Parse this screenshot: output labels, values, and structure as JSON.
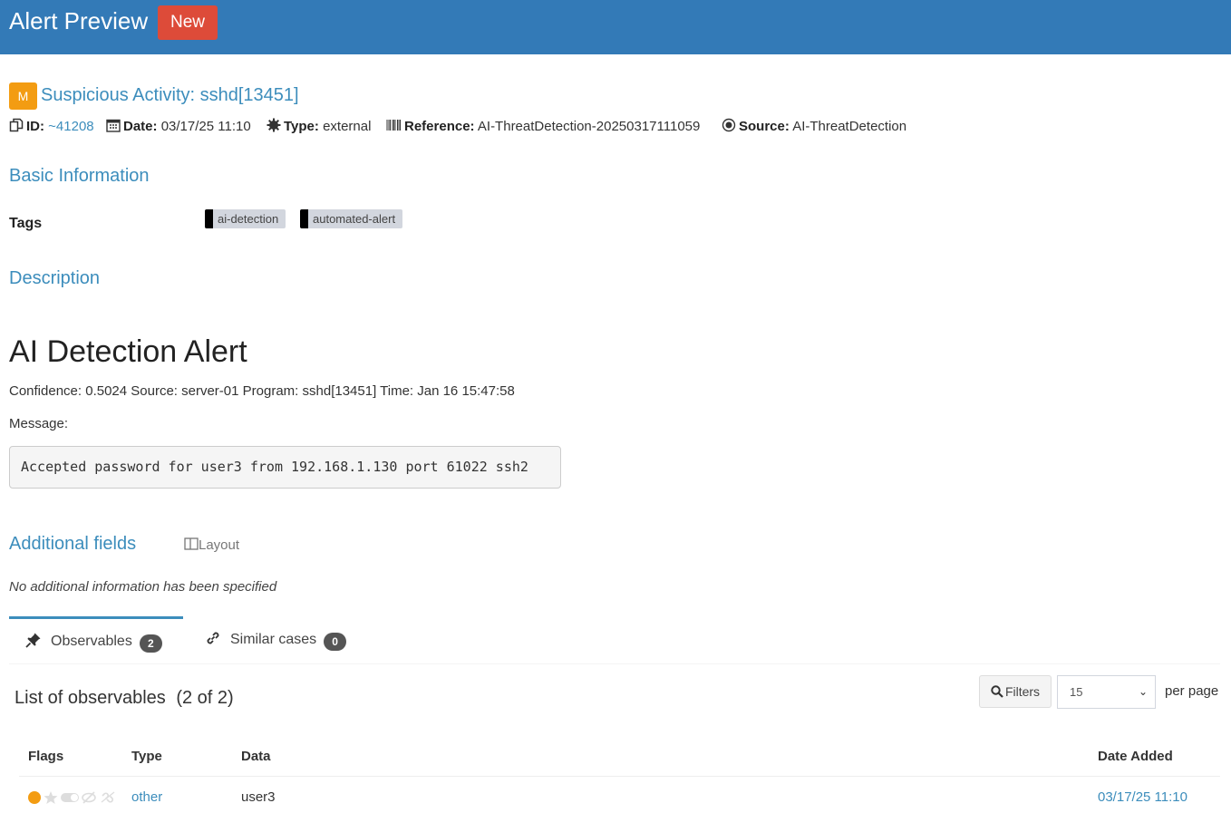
{
  "header": {
    "title": "Alert Preview",
    "status_badge": "New"
  },
  "alert": {
    "severity_letter": "M",
    "severity_color": "#f39c12",
    "title": "Suspicious Activity: sshd[13451]",
    "meta": {
      "id_label": "ID:",
      "id_value": "~41208",
      "date_label": "Date:",
      "date_value": "03/17/25 11:10",
      "type_label": "Type:",
      "type_value": "external",
      "reference_label": "Reference:",
      "reference_value": "AI-ThreatDetection-20250317111059",
      "source_label": "Source:",
      "source_value": "AI-ThreatDetection"
    }
  },
  "basic_info": {
    "title": "Basic Information",
    "tags_label": "Tags",
    "tags": [
      "ai-detection",
      "automated-alert"
    ]
  },
  "description": {
    "title": "Description",
    "heading": "AI Detection Alert",
    "details": "Confidence: 0.5024 Source: server-01 Program: sshd[13451] Time: Jan 16 15:47:58",
    "message_label": "Message:",
    "message_code": "Accepted password for user3 from 192.168.1.130 port 61022 ssh2"
  },
  "additional_fields": {
    "title": "Additional fields",
    "layout_label": "Layout",
    "empty_text": "No additional information has been specified"
  },
  "tabs": [
    {
      "label": "Observables",
      "count": "2",
      "icon": "pin-icon",
      "active": true
    },
    {
      "label": "Similar cases",
      "count": "0",
      "icon": "link-icon",
      "active": false
    }
  ],
  "observables": {
    "list_title": "List of observables",
    "list_count": "(2 of 2)",
    "filters_label": "Filters",
    "per_page_value": "15",
    "per_page_label": "per page",
    "columns": [
      "Flags",
      "Type",
      "Data",
      "Date Added"
    ],
    "rows": [
      {
        "type": "other",
        "data": "user3",
        "date_added": "03/17/25 11:10"
      }
    ]
  },
  "colors": {
    "header_bg": "#337ab7",
    "link": "#3c8dbc",
    "new_badge": "#dd4b39",
    "flag_ioc": "#f39c12"
  }
}
